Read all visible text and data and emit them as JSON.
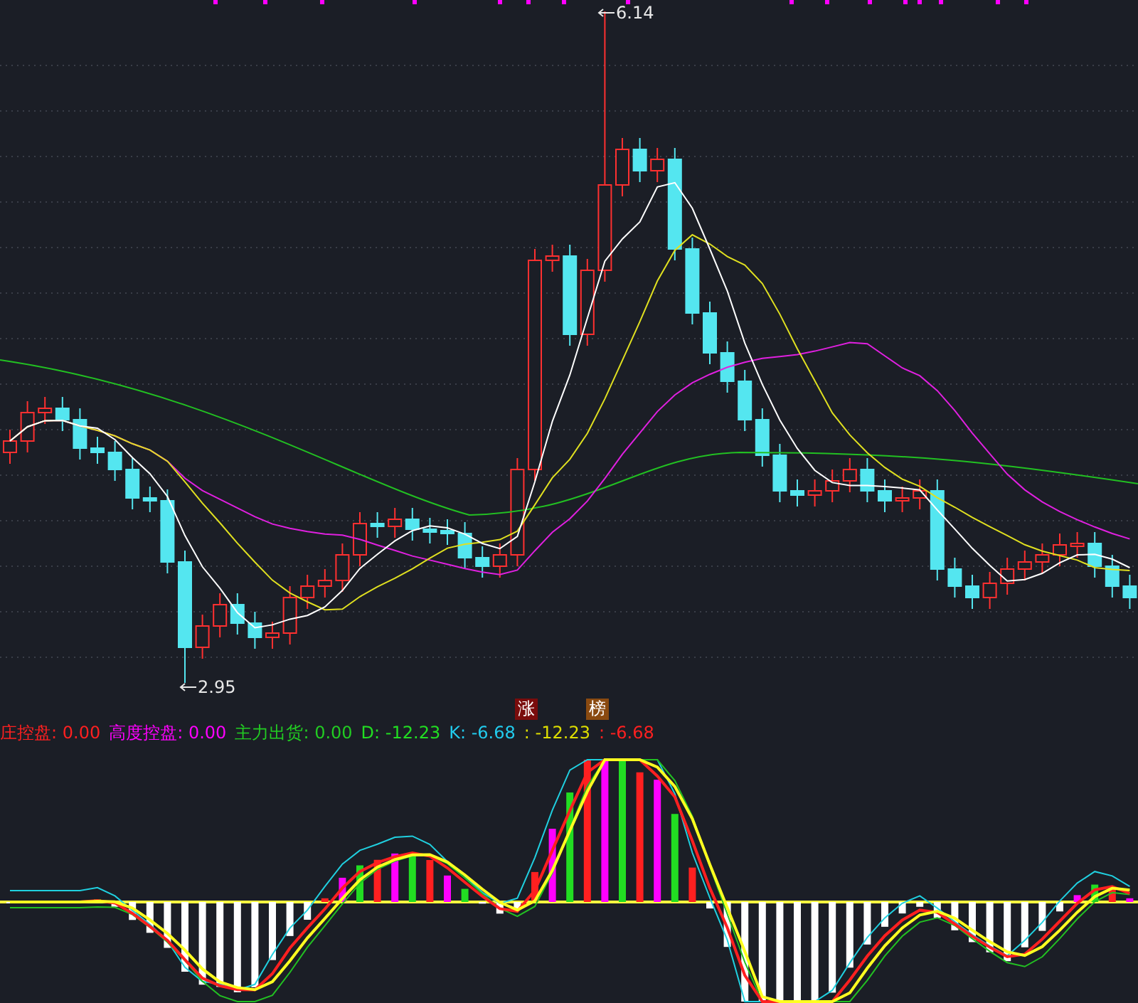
{
  "price_chart": {
    "high_label": "6.14",
    "low_label": "2.95",
    "markers": [
      {
        "text": "涨",
        "color": "#7a0c0c"
      },
      {
        "text": "榜",
        "color": "#8a4a10"
      }
    ]
  },
  "indicator": {
    "legend": [
      {
        "label": "庄控盘:",
        "value": "0.00",
        "color": "#ff2020"
      },
      {
        "label": "高度控盘:",
        "value": "0.00",
        "color": "#ff00ff"
      },
      {
        "label": "主力出货:",
        "value": "0.00",
        "color": "#22cc22"
      },
      {
        "label": "D:",
        "value": "-12.23",
        "color": "#22dd22"
      },
      {
        "label": "K:",
        "value": "-6.68",
        "color": "#22ccee"
      },
      {
        "label": ":",
        "value": "-12.23",
        "color": "#dddd00"
      },
      {
        "label": ":",
        "value": "-6.68",
        "color": "#ff2020"
      }
    ]
  }
}
